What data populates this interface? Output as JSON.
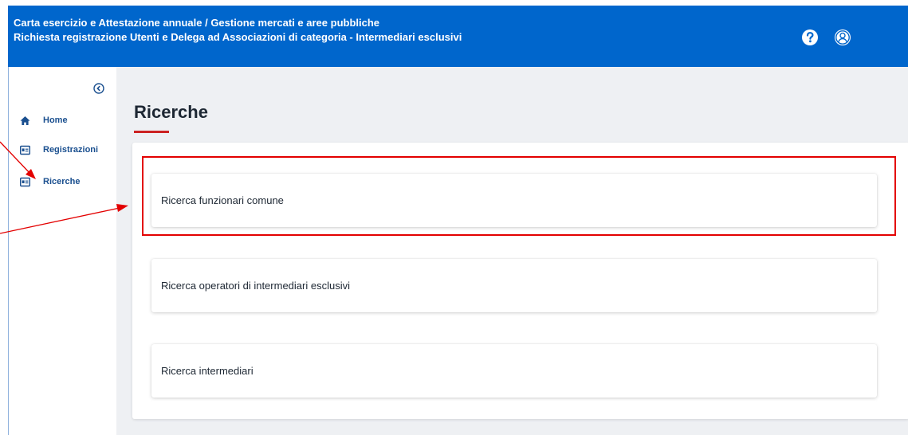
{
  "header": {
    "title_line1": "Carta esercizio e Attestazione annuale / Gestione mercati e aree pubbliche",
    "title_line2": "Richiesta registrazione Utenti e Delega ad Associazioni di categoria - Intermediari esclusivi",
    "icons": [
      "help-icon",
      "user-icon"
    ]
  },
  "sidebar": {
    "collapse_icon": "collapse-icon",
    "items": [
      {
        "label": "Home",
        "icon": "home-icon"
      },
      {
        "label": "Registrazioni",
        "icon": "id-card-icon"
      },
      {
        "label": "Ricerche",
        "icon": "id-card-icon"
      }
    ]
  },
  "main": {
    "title": "Ricerche",
    "cards": [
      {
        "label": "Ricerca funzionari comune"
      },
      {
        "label": "Ricerca operatori di intermediari esclusivi"
      },
      {
        "label": "Ricerca intermediari"
      }
    ]
  },
  "colors": {
    "header_bg": "#0066cc",
    "accent_red": "#cc2222",
    "annotation_red": "#e30000",
    "nav_text": "#1a4f8f"
  }
}
